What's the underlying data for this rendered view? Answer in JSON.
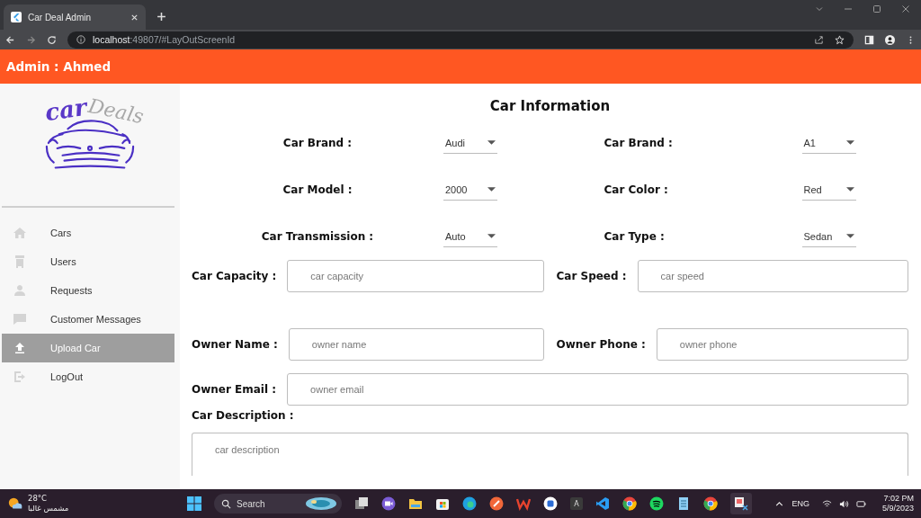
{
  "browser": {
    "tab_title": "Car Deal Admin",
    "url_host": "localhost",
    "url_rest": ":49807/#LayOutScreenId"
  },
  "app_bar": {
    "title": "Admin : Ahmed"
  },
  "logo": {
    "word_1": "car",
    "word_2": "Deals"
  },
  "sidebar": {
    "items": [
      {
        "label": "Cars",
        "kind": "home",
        "selected": false
      },
      {
        "label": "Users",
        "kind": "list",
        "selected": false
      },
      {
        "label": "Requests",
        "kind": "person",
        "selected": false
      },
      {
        "label": "Customer Messages",
        "kind": "chat",
        "selected": false
      },
      {
        "label": "Upload Car",
        "kind": "upload",
        "selected": true
      },
      {
        "label": "LogOut",
        "kind": "logout",
        "selected": false
      }
    ]
  },
  "form": {
    "title": "Car Information",
    "selects": [
      {
        "label": "Car Brand :",
        "value": "Audi"
      },
      {
        "label": "Car Brand :",
        "value": "A1"
      },
      {
        "label": "Car Model :",
        "value": "2000"
      },
      {
        "label": "Car Color :",
        "value": "Red"
      },
      {
        "label": "Car Transmission :",
        "value": "Auto"
      },
      {
        "label": "Car Type :",
        "value": "Sedan"
      }
    ],
    "field_rows": [
      [
        {
          "label": "Car Capacity :",
          "placeholder": "car capacity"
        },
        {
          "label": "Car Speed :",
          "placeholder": "car speed"
        }
      ],
      [
        {
          "label": "Owner Name :",
          "placeholder": "owner name"
        },
        {
          "label": "Owner Phone :",
          "placeholder": "owner phone"
        }
      ],
      [
        {
          "label": "Owner Email :",
          "placeholder": "owner email"
        }
      ]
    ],
    "description": {
      "label": "Car Description :",
      "placeholder": "car description"
    }
  },
  "taskbar": {
    "temperature": "28°C",
    "weather": "مشمس غالبا",
    "search": "Search",
    "app_letter": "A",
    "language": "ENG",
    "time": "7:02 PM",
    "date": "5/9/2023"
  }
}
